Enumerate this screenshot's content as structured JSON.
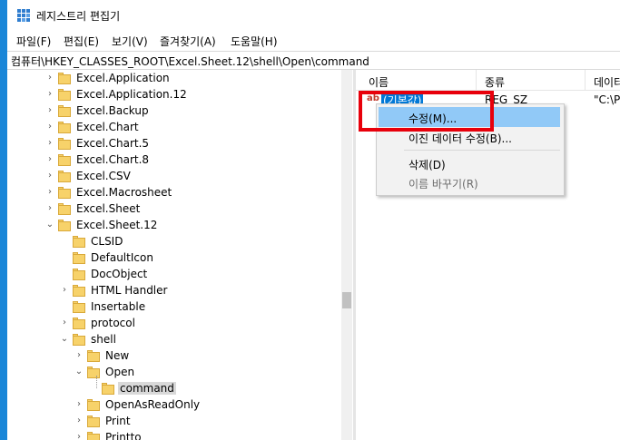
{
  "window": {
    "title": "레지스트리 편집기"
  },
  "menu": [
    "파일(F)",
    "편집(E)",
    "보기(V)",
    "즐겨찾기(A)",
    "도움말(H)"
  ],
  "address": "컴퓨터\\HKEY_CLASSES_ROOT\\Excel.Sheet.12\\shell\\Open\\command",
  "tree": [
    {
      "label": "Excel.Application",
      "depth": 0,
      "expander": "collapsed"
    },
    {
      "label": "Excel.Application.12",
      "depth": 0,
      "expander": "collapsed"
    },
    {
      "label": "Excel.Backup",
      "depth": 0,
      "expander": "collapsed"
    },
    {
      "label": "Excel.Chart",
      "depth": 0,
      "expander": "collapsed"
    },
    {
      "label": "Excel.Chart.5",
      "depth": 0,
      "expander": "collapsed"
    },
    {
      "label": "Excel.Chart.8",
      "depth": 0,
      "expander": "collapsed"
    },
    {
      "label": "Excel.CSV",
      "depth": 0,
      "expander": "collapsed"
    },
    {
      "label": "Excel.Macrosheet",
      "depth": 0,
      "expander": "collapsed"
    },
    {
      "label": "Excel.Sheet",
      "depth": 0,
      "expander": "collapsed"
    },
    {
      "label": "Excel.Sheet.12",
      "depth": 0,
      "expander": "expanded"
    },
    {
      "label": "CLSID",
      "depth": 1,
      "expander": "none"
    },
    {
      "label": "DefaultIcon",
      "depth": 1,
      "expander": "none"
    },
    {
      "label": "DocObject",
      "depth": 1,
      "expander": "none"
    },
    {
      "label": "HTML Handler",
      "depth": 1,
      "expander": "collapsed"
    },
    {
      "label": "Insertable",
      "depth": 1,
      "expander": "none"
    },
    {
      "label": "protocol",
      "depth": 1,
      "expander": "collapsed"
    },
    {
      "label": "shell",
      "depth": 1,
      "expander": "expanded"
    },
    {
      "label": "New",
      "depth": 2,
      "expander": "collapsed"
    },
    {
      "label": "Open",
      "depth": 2,
      "expander": "expanded"
    },
    {
      "label": "command",
      "depth": 3,
      "expander": "none",
      "selected": true
    },
    {
      "label": "OpenAsReadOnly",
      "depth": 2,
      "expander": "collapsed"
    },
    {
      "label": "Print",
      "depth": 2,
      "expander": "collapsed"
    },
    {
      "label": "Printto",
      "depth": 2,
      "expander": "collapsed"
    }
  ],
  "list": {
    "columns": [
      "이름",
      "종류",
      "데이터"
    ],
    "rows": [
      {
        "name": "(기본값)",
        "type": "REG_SZ",
        "data": "\"C:\\Pr"
      }
    ]
  },
  "context_menu": [
    {
      "label": "수정(M)...",
      "state": "hover"
    },
    {
      "label": "이진 데이터 수정(B)...",
      "state": "normal"
    },
    {
      "separator": true
    },
    {
      "label": "삭제(D)",
      "state": "normal"
    },
    {
      "label": "이름 바꾸기(R)",
      "state": "disabled"
    }
  ],
  "colors": {
    "accent": "#0078d7",
    "highlight_border": "#e8000b",
    "menu_hover": "#91c9f7",
    "folder": "#f7d26a"
  }
}
